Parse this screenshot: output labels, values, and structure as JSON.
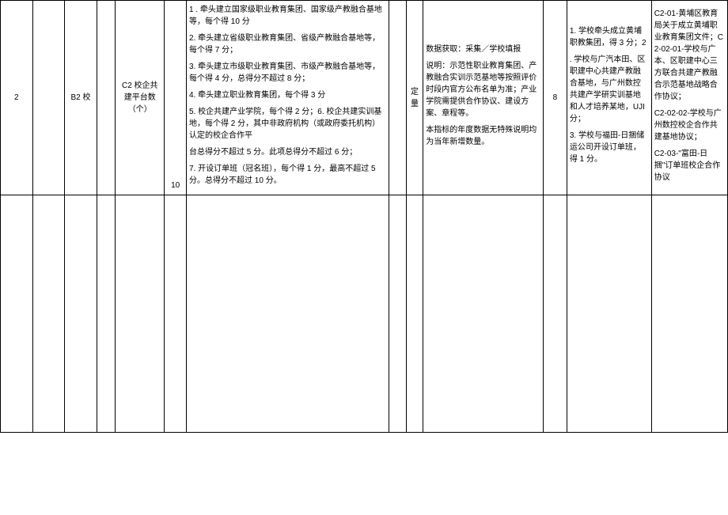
{
  "row": {
    "index": "2",
    "b_code": "B2 校",
    "c_code": "C2 校企共建平台数（个）",
    "num": "10",
    "criteria": {
      "p1": "1 . 牵头建立国家级职业教育集团、国家级产教融合基地等，每个得 10 分",
      "p2": "2. 牵头建立省级职业教育集团、省级产教融合基地等，每个得 7 分；",
      "p3": "3. 牵头建立市级职业教育集团、市级产教融合基地等，每个得 4 分，总得分不超过 8 分；",
      "p4": "4. 牵头建立职业教育集团，每个得 3 分",
      "p5": "5. 校企共建产业学院，每个得 2 分；6. 校企共建实训基地，每个得 2 分，其中非政府机构（或政府委托机构）认定的校企合作平",
      "p6": "台总得分不超过 5 分。此项总得分不超过 6 分；",
      "p7": "7. 开设订单班（冠名班），每个得 1 分，最高不超过 5 分。总得分不超过 10 分。"
    },
    "ding": "定量",
    "source": {
      "p1": "数据获取：采集／学校填报",
      "p2": "说明：示范性职业教育集团、产教融合实训示范基地等按照评价时段内官方公布名单为准；产业学院需提供合作协议、建设方案、章程等。",
      "p3": "本指标的年度数据无特殊说明均为当年新增数量。"
    },
    "score": "8",
    "detail": {
      "p1": "1. 学校牵头成立黄埔职教集团，得 3 分；2",
      "p2": ". 学校与广汽本田、区职建中心共建产教融合基地，与广州数控共建产学研实训基地和人才培养某地，UJI 分；",
      "p3": "3. 学校与福田-日捆储运公司开设订单班，得 1 分。"
    },
    "ref": {
      "p1": "C2-01-黄埔区教育局关于成立黄埔职业教育集团文件；C2-02-01-学校与广本、区职建中心三方联合共建产教融合示范基地战略合作协议；",
      "p2": "C2-02-02-学校与广州数控校企合作共建基地协议；",
      "p3": "C2-03-\"富田-日捆\"订单班校企合作协议"
    }
  }
}
